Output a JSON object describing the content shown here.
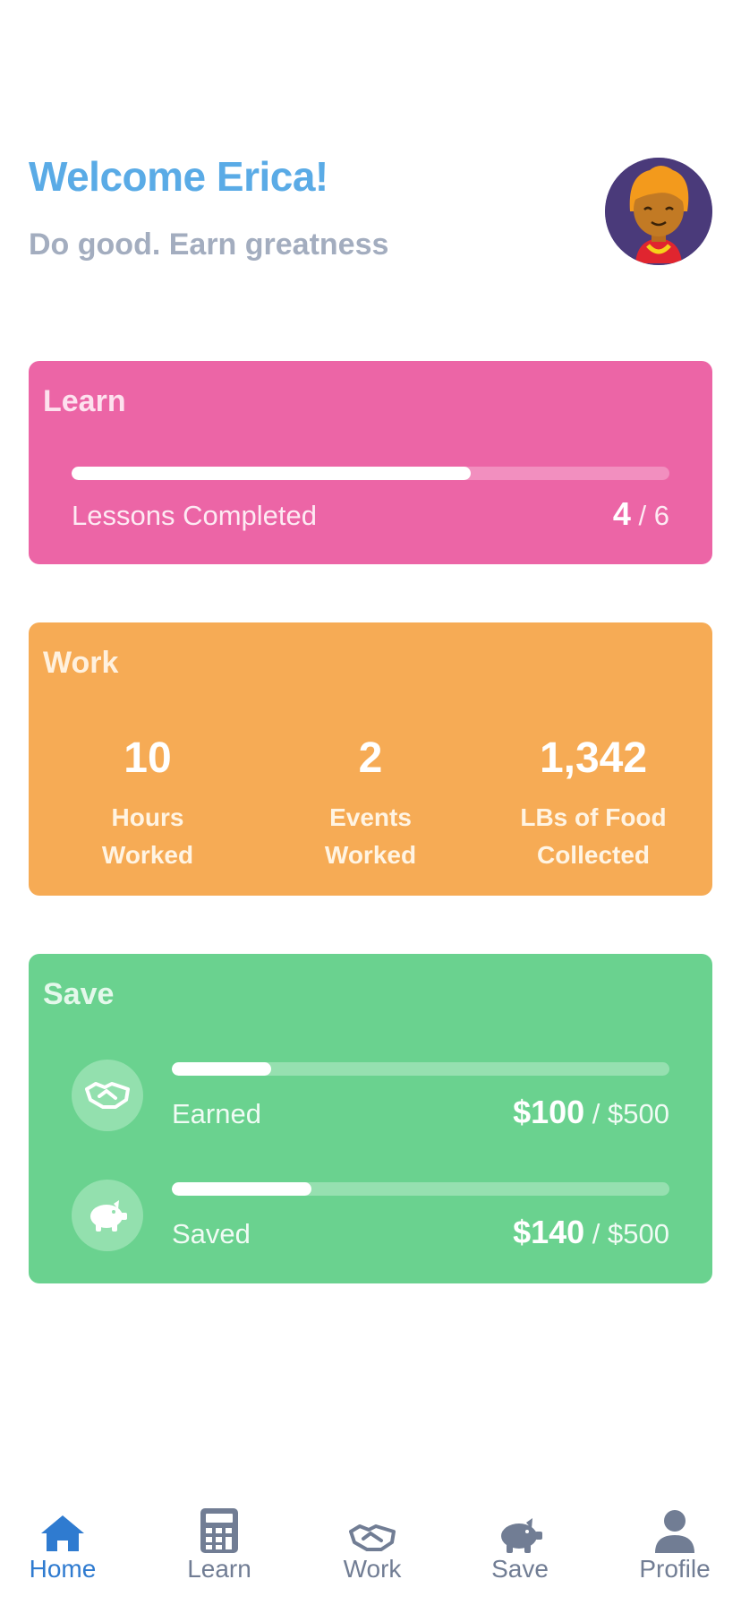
{
  "header": {
    "welcome": "Welcome Erica!",
    "tagline": "Do good. Earn greatness"
  },
  "learn": {
    "title": "Learn",
    "progress_label": "Lessons Completed",
    "completed": "4",
    "total": "/ 6",
    "progress": 0.667
  },
  "work": {
    "title": "Work",
    "stats": [
      {
        "value": "10",
        "label_line1": "Hours",
        "label_line2": "Worked"
      },
      {
        "value": "2",
        "label_line1": "Events",
        "label_line2": "Worked"
      },
      {
        "value": "1,342",
        "label_line1": "LBs of Food",
        "label_line2": "Collected"
      }
    ]
  },
  "save": {
    "title": "Save",
    "rows": [
      {
        "label": "Earned",
        "amount": "$100",
        "goal": "/ $500",
        "progress": 0.2,
        "icon": "handshake-icon"
      },
      {
        "label": "Saved",
        "amount": "$140",
        "goal": "/ $500",
        "progress": 0.28,
        "icon": "piggy-bank-icon"
      }
    ]
  },
  "tabbar": {
    "tabs": [
      {
        "label": "Home",
        "icon": "home-icon",
        "active": true
      },
      {
        "label": "Learn",
        "icon": "calculator-icon",
        "active": false
      },
      {
        "label": "Work",
        "icon": "handshake-icon",
        "active": false
      },
      {
        "label": "Save",
        "icon": "piggy-bank-icon",
        "active": false
      },
      {
        "label": "Profile",
        "icon": "user-icon",
        "active": false
      }
    ]
  },
  "colors": {
    "accent_blue": "#5aabe6",
    "learn_card": "#ec65a6",
    "work_card": "#f6ab55",
    "save_card": "#6ad28f",
    "tab_active": "#2f7bd0",
    "tab_inactive": "#717d94"
  }
}
